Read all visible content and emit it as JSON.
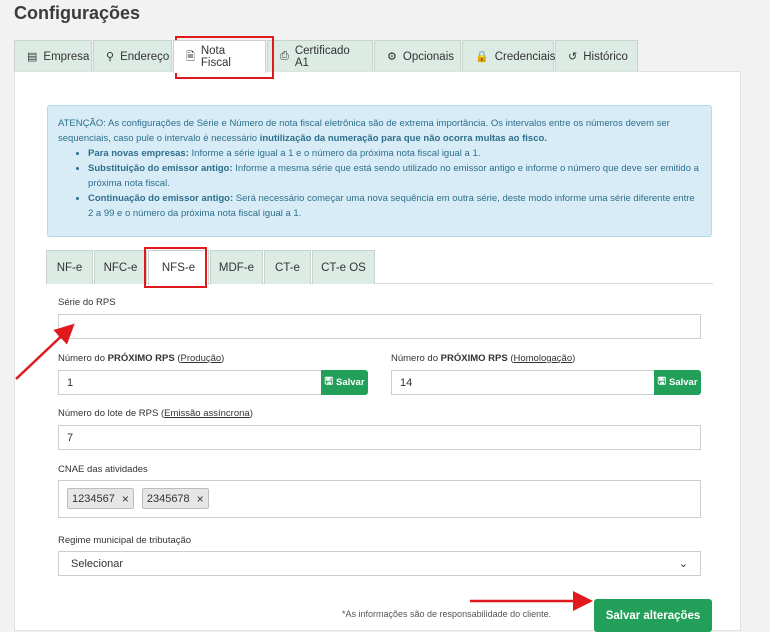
{
  "page": {
    "title": "Configurações"
  },
  "top_tabs": [
    {
      "label": "Empresa",
      "icon": "building-icon",
      "glyph": "▤"
    },
    {
      "label": "Endereço",
      "icon": "map-pin-icon",
      "glyph": "⚲"
    },
    {
      "label": "Nota Fiscal",
      "icon": "document-icon",
      "glyph": "🗎"
    },
    {
      "label": "Certificado A1",
      "icon": "printer-icon",
      "glyph": "⎙"
    },
    {
      "label": "Opcionais",
      "icon": "gear-icon",
      "glyph": "⚙"
    },
    {
      "label": "Credenciais",
      "icon": "lock-icon",
      "glyph": "🔒"
    },
    {
      "label": "Histórico",
      "icon": "history-icon",
      "glyph": "↺"
    }
  ],
  "alert": {
    "heading": "ATENÇÃO:",
    "text": "As configurações de Série e Número de nota fiscal eletrônica são de extrema importância. Os intervalos entre os números devem ser sequenciais, caso pule o intervalo é necessário",
    "strong": "inutilização da numeração para que não ocorra multas ao fisco.",
    "items": [
      {
        "title": "Para novas empresas:",
        "text": "Informe a série igual a 1 e o número da próxima nota fiscal igual a 1."
      },
      {
        "title": "Substituição do emissor antigo:",
        "text": "Informe a mesma série que está sendo utilizado no emissor antigo e informe o número que deve ser emitido a próxima nota fiscal."
      },
      {
        "title": "Continuação do emissor antigo:",
        "text": "Será necessário começar uma nova sequência em outra série, deste modo informe uma série diferente entre 2 a 99 e o número da próxima nota fiscal igual a 1."
      }
    ]
  },
  "sub_tabs": [
    "NF-e",
    "NFC-e",
    "NFS-e",
    "MDF-e",
    "CT-e",
    "CT-e OS"
  ],
  "form": {
    "serie_label": "Série do RPS",
    "serie_value": "",
    "prod_label_a": "Número do ",
    "prod_label_b": "PRÓXIMO RPS",
    "prod_label_c": " (",
    "prod_label_d": "Produção",
    "prod_label_e": ")",
    "prod_value": "1",
    "hom_label_a": "Número do ",
    "hom_label_b": "PRÓXIMO RPS",
    "hom_label_c": " (",
    "hom_label_d": "Homologação",
    "hom_label_e": ")",
    "hom_value": "14",
    "save_label": "Salvar",
    "lote_label_a": "Número do lote de RPS (",
    "lote_label_b": "Emissão assíncrona",
    "lote_label_c": ")",
    "lote_value": "7",
    "cnae_label": "CNAE das atividades",
    "cnae_chips": [
      "1234567",
      "2345678"
    ],
    "regime_label": "Regime municipal de tributação",
    "regime_value": "Selecionar"
  },
  "footer": {
    "note": "*As informações são de responsabilidade do cliente.",
    "save_button": "Salvar alterações"
  },
  "colors": {
    "accent_green": "#22a05a",
    "tab_bg": "#dcebe3",
    "alert_bg": "#d7ecf6",
    "highlight_red": "#e0191e"
  }
}
